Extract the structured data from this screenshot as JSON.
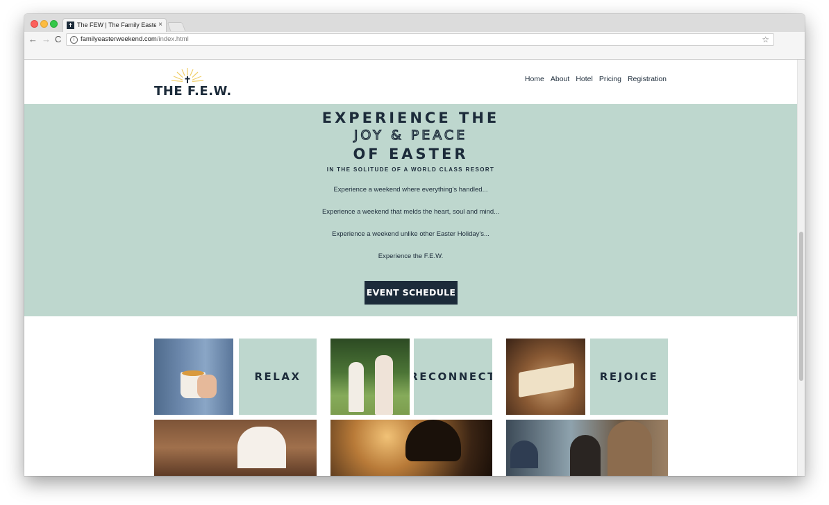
{
  "browser": {
    "tab_title": "The FEW | The Family Easter W",
    "tab_close": "×",
    "url_domain": "familyeasterweekend.com",
    "url_path": "/index.html",
    "nav_back": "←",
    "nav_forward": "→",
    "nav_reload": "C",
    "info_icon": "i",
    "bookmark_icon": "☆"
  },
  "site": {
    "logo_text": "THE F.E.W.",
    "nav": [
      "Home",
      "About",
      "Hotel",
      "Pricing",
      "Registration"
    ]
  },
  "hero": {
    "heading_line1": "EXPERIENCE THE",
    "heading_line2": "JOY & PEACE",
    "heading_line3": "OF EASTER",
    "subheading": "IN THE SOLITUDE OF A WORLD CLASS RESORT",
    "paragraphs": [
      "Experience a weekend where everything's handled...",
      "Experience a weekend that melds the heart, soul and mind...",
      "Experience a weekend unlike other Easter Holiday's...",
      "Experience the F.E.W."
    ],
    "cta": "EVENT SCHEDULE"
  },
  "tiles": {
    "relax": "RELAX",
    "reconnect": "RECONNECT",
    "rejoice": "REJOICE"
  },
  "colors": {
    "accent": "#bed7ce",
    "navy": "#1c2b3a"
  }
}
